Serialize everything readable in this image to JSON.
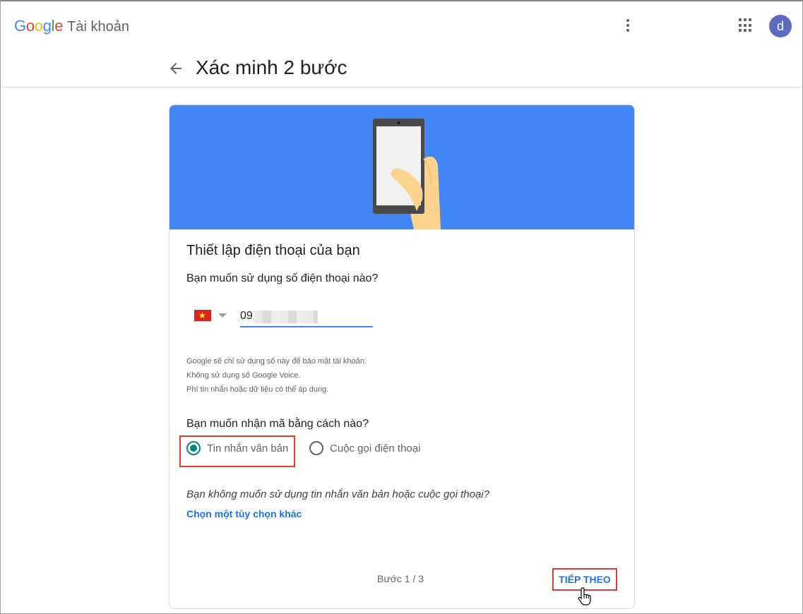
{
  "header": {
    "logo_letters": [
      "G",
      "o",
      "o",
      "g",
      "l",
      "e"
    ],
    "logo_colors": [
      "#4285f4",
      "#ea4335",
      "#fbbc05",
      "#4285f4",
      "#34a853",
      "#ea4335"
    ],
    "product": "Tài khoản",
    "avatar_letter": "d",
    "avatar_color": "#5c6bc0"
  },
  "page": {
    "title": "Xác minh 2 bước"
  },
  "card": {
    "hero_color": "#4285f4",
    "section_title": "Thiết lập điện thoại của bạn",
    "phone_question": "Bạn muốn sử dụng số điện thoại nào?",
    "country_flag": "vn-flag-icon",
    "phone_value": "09",
    "notes": [
      "Google sẽ chỉ sử dụng số này để bảo mật tài khoản.",
      "Không sử dụng số Google Voice.",
      "Phí tin nhắn hoặc dữ liệu có thể áp dụng."
    ],
    "method_question": "Bạn muốn nhận mã bằng cách nào?",
    "methods": [
      {
        "label": "Tin nhắn văn bản",
        "selected": true
      },
      {
        "label": "Cuộc gọi điện thoại",
        "selected": false
      }
    ],
    "alt_question": "Bạn không muốn sử dụng tin nhắn văn bản hoặc cuộc gọi thoại?",
    "alt_link": "Chọn một tùy chọn khác",
    "step": "Bước 1 / 3",
    "next_button": "TIẾP THEO",
    "highlight_color": "#e53935",
    "accent_color": "#00897b"
  }
}
